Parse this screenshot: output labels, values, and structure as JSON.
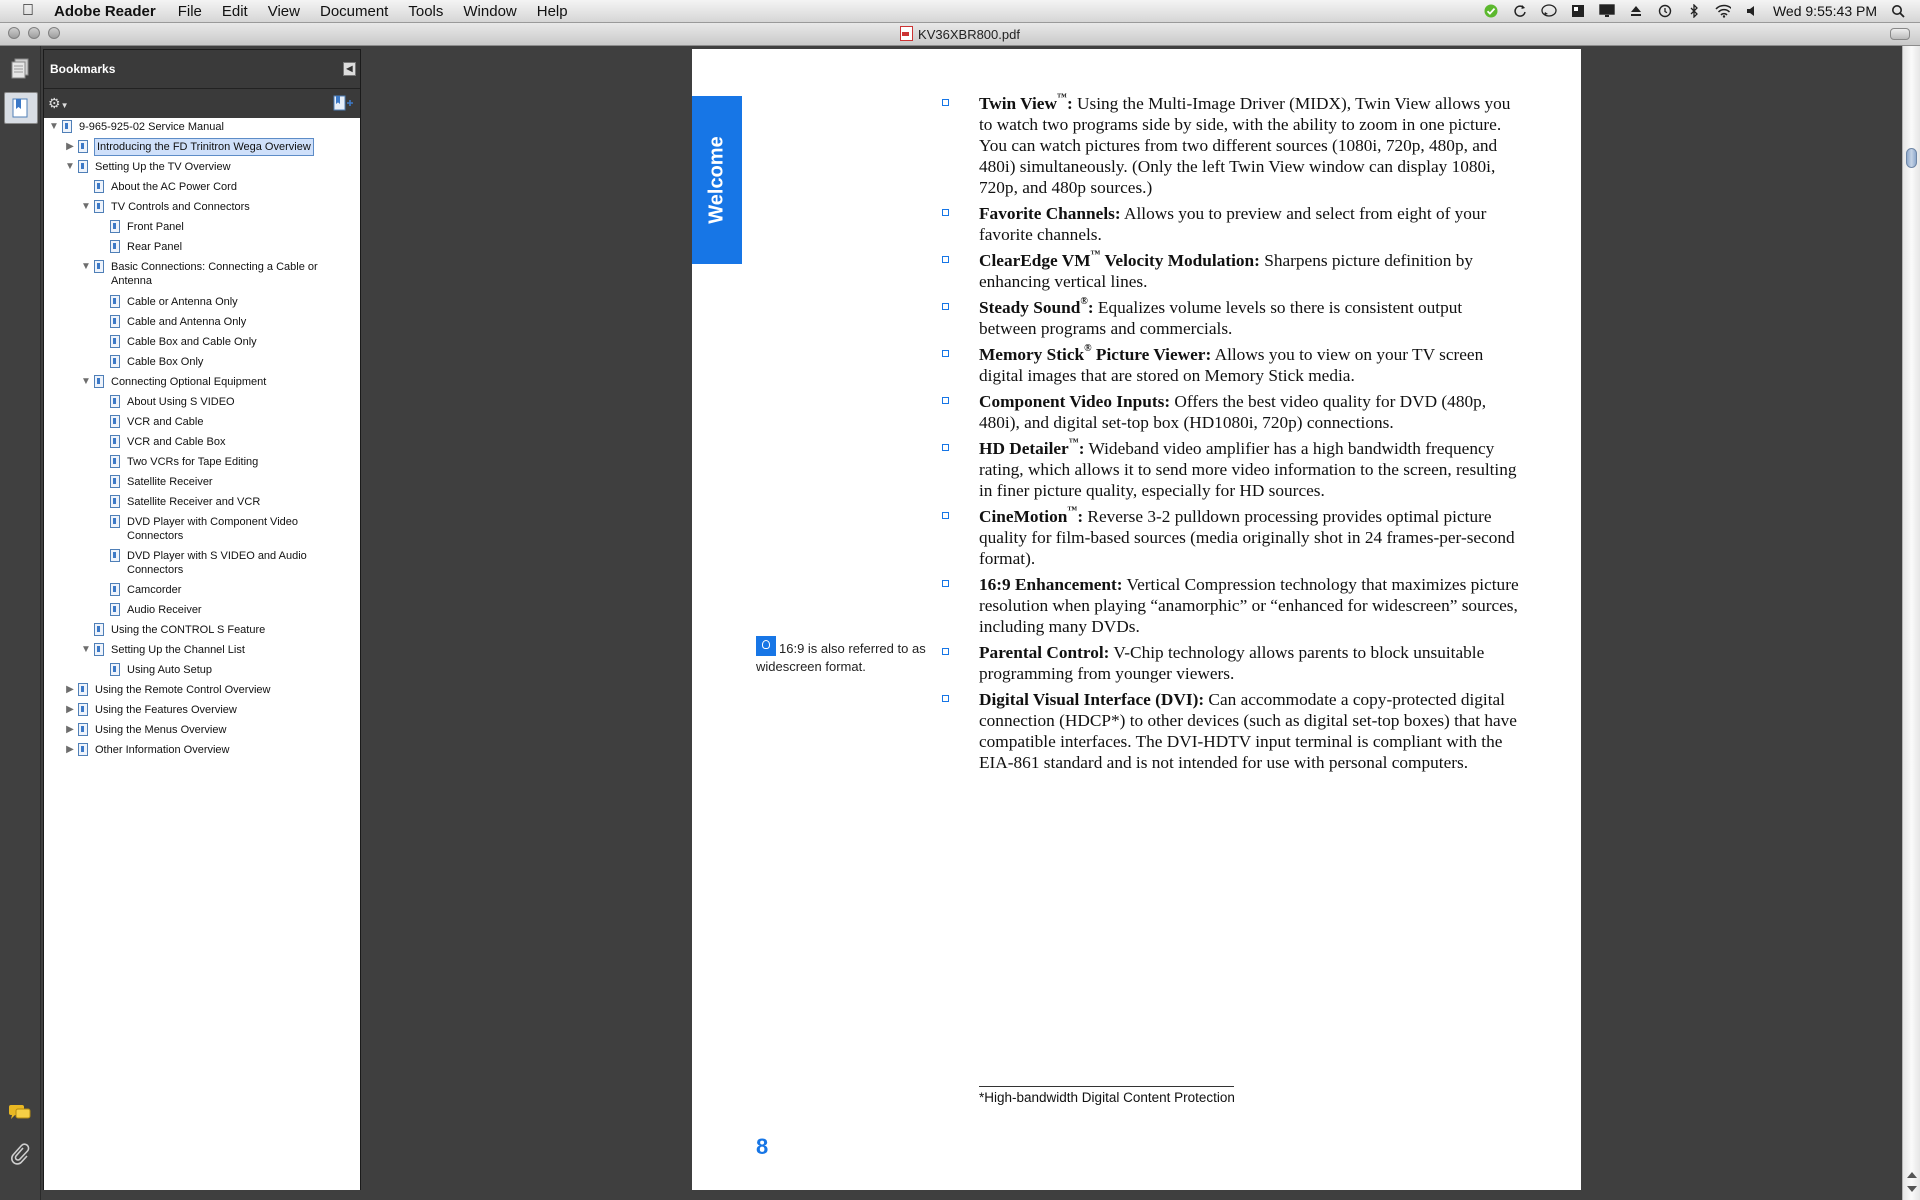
{
  "menubar": {
    "app_name": "Adobe Reader",
    "menus": [
      "File",
      "Edit",
      "View",
      "Document",
      "Tools",
      "Window",
      "Help"
    ],
    "clock": "Wed 9:55:43 PM"
  },
  "window": {
    "title": "KV36XBR800.pdf"
  },
  "bookmarks": {
    "header": "Bookmarks",
    "items": [
      {
        "label": "9-965-925-02 Service Manual",
        "toggle": "expanded",
        "selected": false
      },
      {
        "label": "Introducing the FD Trinitron Wega Overview",
        "toggle": "collapsed",
        "selected": true
      },
      {
        "label": "Setting Up the TV Overview",
        "toggle": "expanded",
        "selected": false
      },
      {
        "label": "About the AC Power Cord",
        "toggle": "none",
        "selected": false
      },
      {
        "label": "TV Controls and Connectors",
        "toggle": "expanded",
        "selected": false
      },
      {
        "label": "Front Panel",
        "toggle": "none",
        "selected": false
      },
      {
        "label": "Rear Panel",
        "toggle": "none",
        "selected": false
      },
      {
        "label": "Basic Connections: Connecting a Cable or",
        "label2": "Antenna",
        "toggle": "expanded",
        "selected": false
      },
      {
        "label": "Cable or Antenna Only",
        "toggle": "none",
        "selected": false
      },
      {
        "label": "Cable and Antenna Only",
        "toggle": "none",
        "selected": false
      },
      {
        "label": "Cable Box and Cable Only",
        "toggle": "none",
        "selected": false
      },
      {
        "label": "Cable Box Only",
        "toggle": "none",
        "selected": false
      },
      {
        "label": "Connecting Optional Equipment",
        "toggle": "expanded",
        "selected": false
      },
      {
        "label": "About Using S VIDEO",
        "toggle": "none",
        "selected": false
      },
      {
        "label": "VCR and Cable",
        "toggle": "none",
        "selected": false
      },
      {
        "label": "VCR and Cable Box",
        "toggle": "none",
        "selected": false
      },
      {
        "label": "Two VCRs for Tape Editing",
        "toggle": "none",
        "selected": false
      },
      {
        "label": "Satellite Receiver",
        "toggle": "none",
        "selected": false
      },
      {
        "label": "Satellite Receiver and VCR",
        "toggle": "none",
        "selected": false
      },
      {
        "label": "DVD Player with Component Video",
        "label2": "Connectors",
        "toggle": "none",
        "selected": false
      },
      {
        "label": "DVD Player with S VIDEO and Audio",
        "label2": "Connectors",
        "toggle": "none",
        "selected": false
      },
      {
        "label": "Camcorder",
        "toggle": "none",
        "selected": false
      },
      {
        "label": "Audio Receiver",
        "toggle": "none",
        "selected": false
      },
      {
        "label": "Using the CONTROL S Feature",
        "toggle": "none",
        "selected": false
      },
      {
        "label": "Setting Up the Channel List",
        "toggle": "expanded",
        "selected": false
      },
      {
        "label": "Using Auto Setup",
        "toggle": "none",
        "selected": false
      },
      {
        "label": "Using the Remote Control Overview",
        "toggle": "collapsed",
        "selected": false
      },
      {
        "label": "Using the Features Overview",
        "toggle": "collapsed",
        "selected": false
      },
      {
        "label": "Using the Menus Overview",
        "toggle": "collapsed",
        "selected": false
      },
      {
        "label": "Other Information Overview",
        "toggle": "collapsed",
        "selected": false
      }
    ]
  },
  "page": {
    "section_tab": "Welcome",
    "features": [
      {
        "title": "Twin View",
        "mark": "™",
        "sep": ":",
        "text": " Using the Multi-Image Driver (MIDX), Twin View allows you to watch two programs side by side, with the ability to zoom in one picture. You can watch pictures from two different sources (1080i, 720p, 480p, and 480i) simultaneously. (Only the left Twin View window can display 1080i, 720p, and 480p sources.)"
      },
      {
        "title": "Favorite Channels",
        "mark": "",
        "sep": ":",
        "text": " Allows you to preview and select from eight of your favorite channels."
      },
      {
        "title": "ClearEdge VM",
        "mark": "™",
        "sep": " Velocity Modulation:",
        "text": " Sharpens picture definition by enhancing vertical lines."
      },
      {
        "title": "Steady Sound",
        "mark": "®",
        "sep": ":",
        "text": " Equalizes volume levels so there is consistent output between programs and commercials."
      },
      {
        "title": "Memory Stick",
        "mark": "®",
        "sep": " Picture Viewer:",
        "text": " Allows you to view on your TV screen digital images that are stored on Memory Stick media."
      },
      {
        "title": "Component Video Inputs:",
        "mark": "",
        "sep": "",
        "text": " Offers the best video quality for DVD (480p, 480i), and digital set-top box (HD1080i, 720p) connections."
      },
      {
        "title": "HD Detailer",
        "mark": "™",
        "sep": ":",
        "text": " Wideband video amplifier has a high bandwidth frequency rating, which allows it to send more video information to the screen, resulting in finer picture quality, especially for HD sources."
      },
      {
        "title": "CineMotion",
        "mark": "™",
        "sep": ":",
        "text": " Reverse 3-2 pulldown processing provides optimal picture quality for film-based sources (media originally shot in 24 frames-per-second format)."
      },
      {
        "title": "16:9 Enhancement:",
        "mark": "",
        "sep": "",
        "text": " Vertical Compression technology that maximizes picture resolution when playing “anamorphic” or “enhanced for widescreen” sources, including many DVDs."
      },
      {
        "title": "Parental Control:",
        "mark": "",
        "sep": "",
        "text": " V-Chip technology allows parents to block unsuitable programming from younger viewers."
      },
      {
        "title": "Digital Visual Interface (DVI):",
        "mark": "",
        "sep": "",
        "text": " Can accommodate a copy-protected digital connection (HDCP*) to other devices (such as digital set-top boxes) that have compatible interfaces. The DVI-HDTV input terminal is compliant with the EIA-861 standard and is not intended for use with personal computers."
      }
    ],
    "note": "16:9 is also referred to as widescreen format.",
    "footnote": "*High-bandwidth Digital Content Protection",
    "page_number": "8"
  }
}
